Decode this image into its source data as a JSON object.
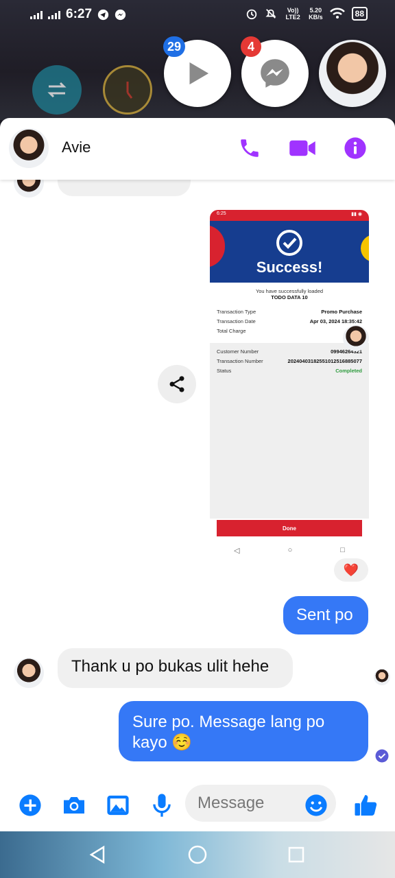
{
  "status_bar": {
    "time": "6:27",
    "network": "Vo)) LTE2",
    "speed": "5.20",
    "speed_unit": "KB/s",
    "battery": "88"
  },
  "chat_heads": [
    {
      "name": "play",
      "badge": "29"
    },
    {
      "name": "messenger",
      "badge": "4"
    },
    {
      "name": "avie-head",
      "badge": ""
    }
  ],
  "header": {
    "contact_name": "Avie"
  },
  "messages": {
    "cut_off_number": "09946264321",
    "sent": "Sent po",
    "received": "Thank u po bukas ulit hehe",
    "reply": "Sure po. Message lang po kayo ☺️",
    "reaction": "❤️"
  },
  "screenshot": {
    "status_time": "6:25",
    "title": "Success!",
    "subtitle": "You have successfully loaded",
    "product": "TODO DATA 10",
    "rows_top": [
      {
        "label": "Transaction Type",
        "value": "Promo Purchase"
      },
      {
        "label": "Transaction Date",
        "value": "Apr 03, 2024 18:35:42"
      },
      {
        "label": "Total Charge",
        "value": ""
      }
    ],
    "rows_bottom": [
      {
        "label": "Customer Number",
        "value": "09946264321"
      },
      {
        "label": "Transaction Number",
        "value": "20240403182551012516885077"
      },
      {
        "label": "Status",
        "value": "Completed"
      }
    ],
    "done_label": "Done"
  },
  "composer": {
    "placeholder": "Message"
  },
  "colors": {
    "messenger_blue": "#3578f6",
    "header_purple": "#a033ff",
    "accent_blue": "#0a7cff"
  }
}
